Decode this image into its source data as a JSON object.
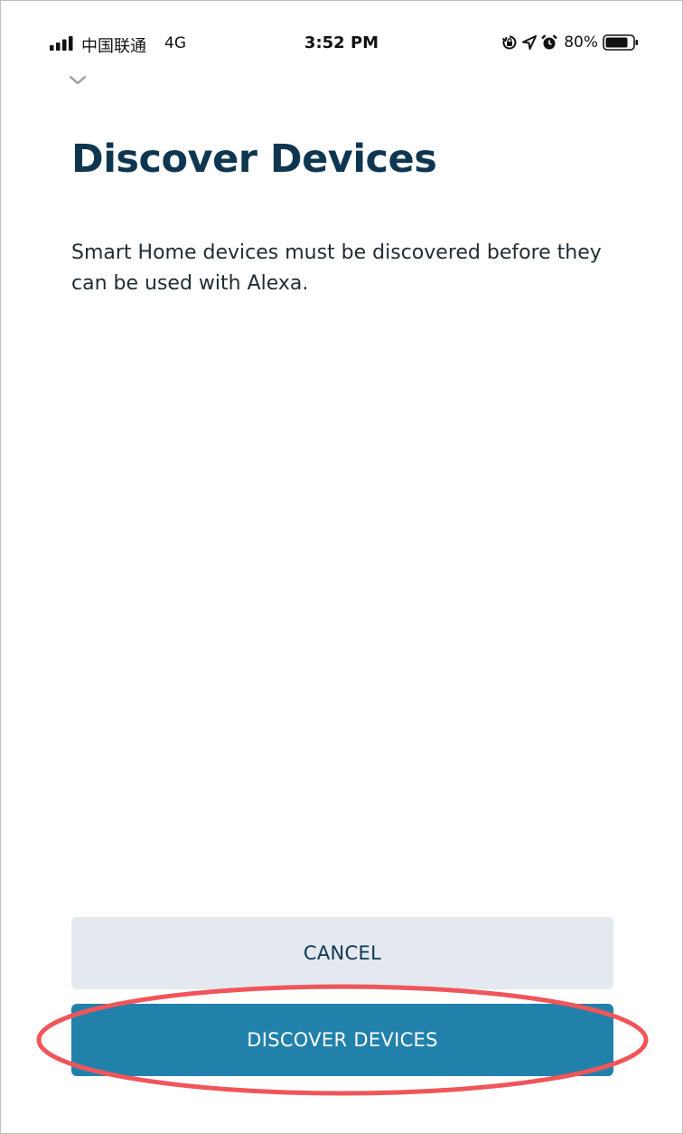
{
  "status_bar": {
    "carrier": "中国联通",
    "network": "4G",
    "time": "3:52 PM",
    "battery_percent": "80%",
    "icons": [
      "signal-bars-icon",
      "orientation-lock-icon",
      "location-arrow-icon",
      "alarm-clock-icon",
      "battery-icon"
    ]
  },
  "header": {
    "collapse_icon": "chevron-down-icon"
  },
  "main": {
    "title": "Discover Devices",
    "description": "Smart Home devices must be discovered before they can be used with Alexa."
  },
  "actions": {
    "cancel_label": "CANCEL",
    "discover_label": "DISCOVER DEVICES"
  },
  "colors": {
    "title": "#0f3651",
    "primary_button": "#2181ab",
    "secondary_button": "#e3e9ef",
    "highlight_annotation": "#f0555a"
  }
}
